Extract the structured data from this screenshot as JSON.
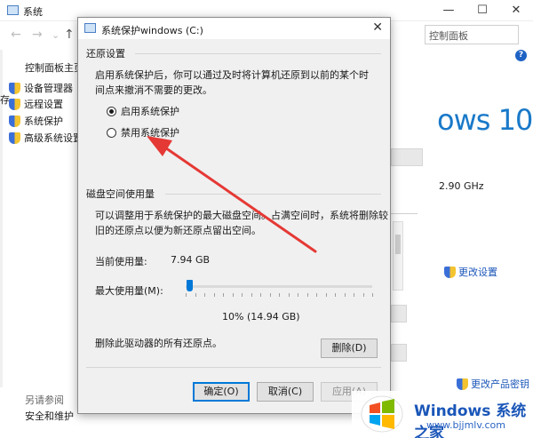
{
  "background_window": {
    "title": "系统",
    "address": "控制面板",
    "sidebar_title": "控制面板主页",
    "sidebar_items": [
      {
        "label": "设备管理器"
      },
      {
        "label": "远程设置"
      },
      {
        "label": "系统保护"
      },
      {
        "label": "高级系统设置"
      }
    ],
    "cut_char": "存",
    "see_also": "另请参阅",
    "security_link": "安全和维护",
    "windows_version": "ows 10",
    "cpu_speed": "2.90 GHz",
    "change_settings": "更改设置",
    "change_product_key": "更改产品密钥",
    "help_label": "?"
  },
  "dialog": {
    "title": "系统保护windows (C:)",
    "close_glyph": "✕",
    "restore_section": {
      "header": "还原设置",
      "description": "启用系统保护后，你可以通过及时将计算机还原到以前的某个时间点来撤消不需要的更改。",
      "options": [
        {
          "label": "启用系统保护",
          "checked": true
        },
        {
          "label": "禁用系统保护",
          "checked": false
        }
      ]
    },
    "disk_section": {
      "header": "磁盘空间使用量",
      "description": "可以调整用于系统保护的最大磁盘空间。占满空间时，系统将删除较旧的还原点以便为新还原点留出空间。",
      "current_usage_label": "当前使用量:",
      "current_usage_value": "7.94 GB",
      "max_usage_label": "最大使用量(M):",
      "max_usage_fraction": 0.1,
      "max_usage_text": "10% (14.94 GB)"
    },
    "delete_text": "删除此驱动器的所有还原点。",
    "delete_button": "删除(D)",
    "buttons": {
      "ok": "确定(O)",
      "cancel": "取消(C)",
      "apply": "应用(A)"
    }
  },
  "watermark": {
    "brand": "Windows",
    "brand_cn": "系统之家",
    "url": "www.bjjmlv.com"
  },
  "colors": {
    "accent": "#0078d7",
    "arrow": "#e53935",
    "link": "#1a56b8"
  }
}
